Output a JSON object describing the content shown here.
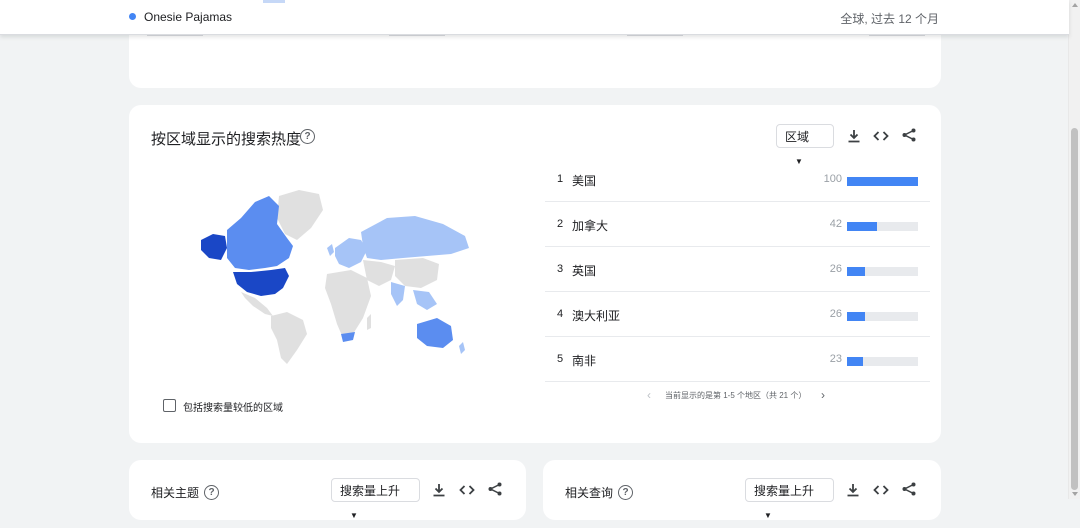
{
  "header": {
    "term_label": "Onesie Pajamas",
    "term_meta": "全球, 过去 12 个月"
  },
  "region_card": {
    "title": "按区域显示的搜索热度",
    "help_glyph": "?",
    "resolution_select": "区域",
    "regions": [
      {
        "rank": "1",
        "name": "美国",
        "value": "100",
        "level": 1.0
      },
      {
        "rank": "2",
        "name": "加拿大",
        "value": "42",
        "level": 0.42
      },
      {
        "rank": "3",
        "name": "英国",
        "value": "26",
        "level": 0.26
      },
      {
        "rank": "4",
        "name": "澳大利亚",
        "value": "26",
        "level": 0.26
      },
      {
        "rank": "5",
        "name": "南非",
        "value": "23",
        "level": 0.23
      }
    ],
    "pager_text": "当前显示的是第 1-5 个地区（共 21 个）",
    "checkbox_label": "包括搜索量较低的区域"
  },
  "related_topics": {
    "title": "相关主题",
    "select": "搜索量上升"
  },
  "related_queries": {
    "title": "相关查询",
    "select": "搜索量上升"
  },
  "colors": {
    "accent": "#4285f4",
    "map_high": "#1a47c6",
    "map_mid": "#5b8df0",
    "map_low": "#a6c4f7",
    "map_none": "#e0e0e0"
  }
}
